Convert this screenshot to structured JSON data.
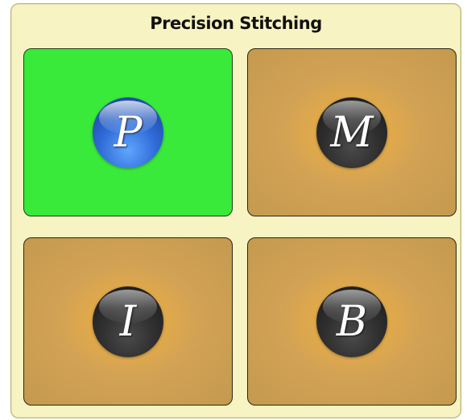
{
  "panel": {
    "title": "Precision Stitching"
  },
  "tiles": [
    {
      "id": "P",
      "letter": "P",
      "selected": true,
      "icon": "p-letter-icon"
    },
    {
      "id": "M",
      "letter": "M",
      "selected": false,
      "icon": "m-letter-icon"
    },
    {
      "id": "I",
      "letter": "I",
      "selected": false,
      "icon": "i-letter-icon"
    },
    {
      "id": "B",
      "letter": "B",
      "selected": false,
      "icon": "b-letter-icon"
    }
  ],
  "colors": {
    "panel_bg": "#f8f3c2",
    "tile_selected": "#39ea3b",
    "tile_default": "#d2a255",
    "ball_selected": "#2f6bd6",
    "ball_default": "#2f2f2f"
  }
}
